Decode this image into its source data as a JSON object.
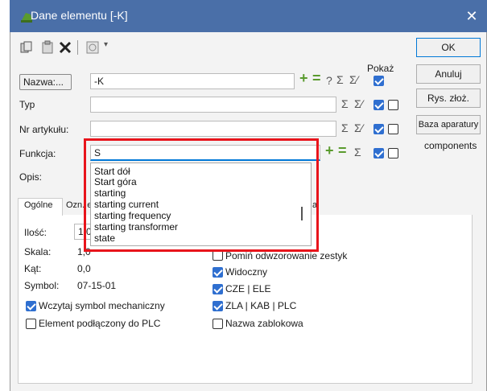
{
  "window": {
    "title": "Dane elementu [-K]",
    "close_glyph": "✕"
  },
  "toolbar": {
    "icons": [
      "copy-icon",
      "paste-icon",
      "delete-icon",
      "symbol-icon"
    ],
    "dropdown_glyph": "▾"
  },
  "header": {
    "pokaz": "Pokaż"
  },
  "fields": {
    "nazwa": {
      "label": "Nazwa:...",
      "value": "-K",
      "checked": true
    },
    "typ": {
      "label": "Typ",
      "value": "",
      "checked_a": true,
      "checked_b": false
    },
    "nr_artykulu": {
      "label": "Nr artykułu:",
      "value": "",
      "checked_a": true,
      "checked_b": false
    },
    "funkcja": {
      "label": "Funkcja:",
      "value": "S",
      "checked_a": true,
      "checked_b": false
    },
    "opis": {
      "label": "Opis:"
    }
  },
  "symbols": {
    "plus": "+",
    "minus": "=",
    "question": "?",
    "sigma": "Σ",
    "sigma2": "Σ⁄"
  },
  "side_buttons": {
    "ok": "OK",
    "cancel": "Anuluj",
    "rys": "Rys. złoż.",
    "baza": "Baza aparatury",
    "components": "components"
  },
  "tabs": {
    "ogolne": "Ogólne",
    "ozn": "Ozn. e",
    "tail": "a"
  },
  "general": {
    "ilosc_label": "Ilość:",
    "ilosc_value": "1,0",
    "skala_label": "Skala:",
    "skala_value": "1,0",
    "kat_label": "Kąt:",
    "kat_value": "0,0",
    "symbol_label": "Symbol:",
    "symbol_value": "07-15-01",
    "wczytaj": "Wczytaj symbol mechaniczny",
    "plc": "Element podłączony do PLC",
    "pomin": "Pomiń odwzorowanie zestyk",
    "widoczny": "Widoczny",
    "cze": "CZE | ELE",
    "zla": "ZLA | KAB | PLC",
    "nazwa_zabl": "Nazwa zablokowa"
  },
  "dropdown": {
    "items": [
      "Start dół",
      "Start góra",
      "starting",
      "starting current",
      "starting frequency",
      "starting transformer",
      "state"
    ]
  },
  "colors": {
    "titlebar": "#4a6fa8",
    "highlight": "#e8141b",
    "accent": "#2f6fd0"
  }
}
